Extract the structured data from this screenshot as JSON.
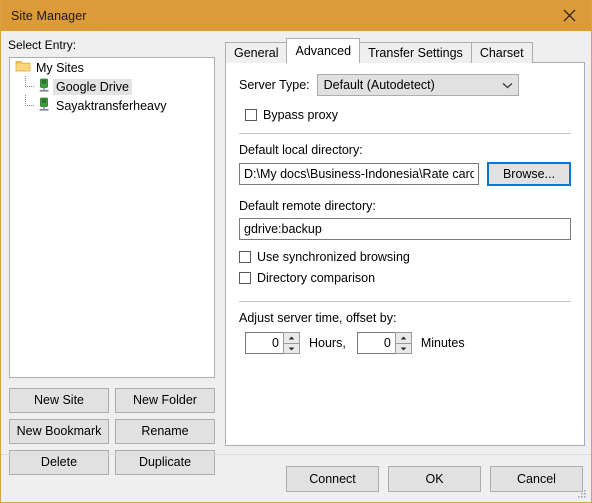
{
  "window": {
    "title": "Site Manager",
    "close_icon": "close-icon",
    "accent_color": "#dc9a38"
  },
  "left": {
    "select_entry_label": "Select Entry:",
    "tree": [
      {
        "label": "My Sites",
        "icon": "folder-icon",
        "level": 0,
        "selected": false
      },
      {
        "label": "Google Drive",
        "icon": "server-icon",
        "level": 1,
        "selected": true
      },
      {
        "label": "Sayaktransferheavy",
        "icon": "server-icon",
        "level": 1,
        "selected": false
      }
    ],
    "buttons": [
      {
        "label": "New Site",
        "name": "new-site-button"
      },
      {
        "label": "New Folder",
        "name": "new-folder-button"
      },
      {
        "label": "New Bookmark",
        "name": "new-bookmark-button"
      },
      {
        "label": "Rename",
        "name": "rename-button"
      },
      {
        "label": "Delete",
        "name": "delete-button"
      },
      {
        "label": "Duplicate",
        "name": "duplicate-button"
      }
    ]
  },
  "right": {
    "tabs": [
      {
        "label": "General",
        "active": false
      },
      {
        "label": "Advanced",
        "active": true
      },
      {
        "label": "Transfer Settings",
        "active": false
      },
      {
        "label": "Charset",
        "active": false
      }
    ],
    "server_type": {
      "label": "Server Type:",
      "value": "Default (Autodetect)",
      "arrow_icon": "chevron-down-icon"
    },
    "bypass_proxy": {
      "label": "Bypass proxy",
      "checked": false
    },
    "local_directory": {
      "label": "Default local directory:",
      "value": "D:\\My docs\\Business-Indonesia\\Rate card",
      "placeholder": "",
      "browse_label": "Browse..."
    },
    "remote_directory": {
      "label": "Default remote directory:",
      "value": "gdrive:backup",
      "placeholder": ""
    },
    "sync_browsing": {
      "label": "Use synchronized browsing",
      "checked": false
    },
    "directory_comparison": {
      "label": "Directory comparison",
      "checked": false
    },
    "adjust_time": {
      "label": "Adjust server time, offset by:",
      "hours_value": "0",
      "hours_label": "Hours,",
      "minutes_value": "0",
      "minutes_label": "Minutes"
    }
  },
  "footer": {
    "connect_label": "Connect",
    "ok_label": "OK",
    "cancel_label": "Cancel",
    "grip_icon": "resize-grip-icon"
  }
}
